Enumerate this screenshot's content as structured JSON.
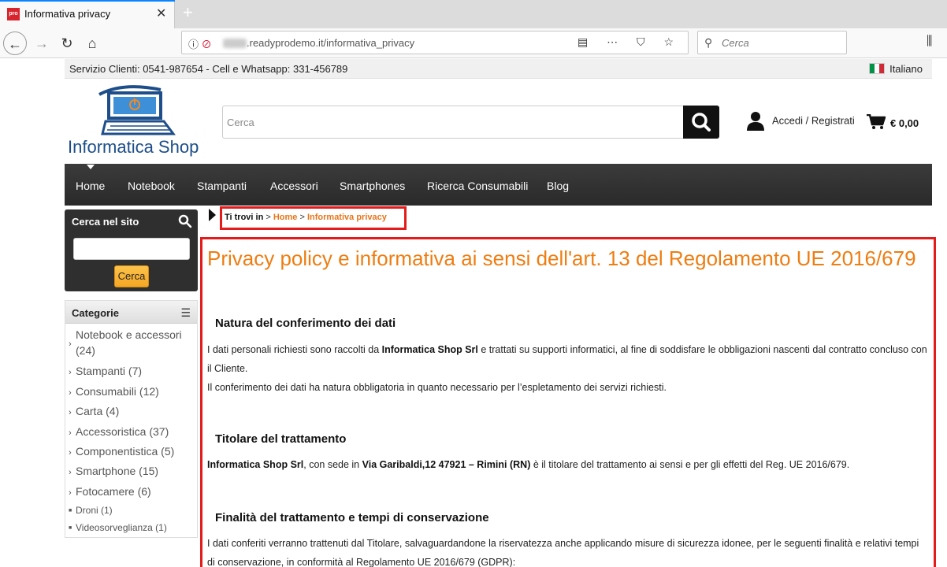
{
  "browser": {
    "tab_title": "Informativa privacy",
    "favicon_text": "pro",
    "url_prefix": "",
    "url": ".readyprodemo.it/informativa_privacy",
    "search_placeholder": "Cerca"
  },
  "topstrip": {
    "service": "Servizio Clienti: 0541-987654 - Cell e Whatsapp: 331-456789",
    "language": "Italiano"
  },
  "header": {
    "logo_text": "Informatica Shop",
    "search_placeholder": "Cerca",
    "login_label": "Accedi / Registrati",
    "cart_total": "€ 0,00"
  },
  "mainnav": {
    "items": [
      "Home",
      "Notebook",
      "Stampanti",
      "Accessori",
      "Smartphones",
      "Ricerca Consumabili",
      "Blog"
    ]
  },
  "sidebar": {
    "search_title": "Cerca nel sito",
    "search_button": "Cerca",
    "categories_title": "Categorie",
    "categories": [
      {
        "label": "Notebook e accessori",
        "count": "(24)"
      },
      {
        "label": "Stampanti (7)"
      },
      {
        "label": "Consumabili (12)"
      },
      {
        "label": "Carta (4)"
      },
      {
        "label": "Accessoristica (37)"
      },
      {
        "label": "Componentistica (5)"
      },
      {
        "label": "Smartphone (15)"
      },
      {
        "label": "Fotocamere (6)"
      },
      {
        "label": "Droni (1)"
      },
      {
        "label": "Videosorveglianza (1)"
      }
    ]
  },
  "breadcrumb": {
    "prefix": "Ti trovi in",
    "sep1": " > ",
    "home": "Home",
    "sep2": " > ",
    "current": "Informativa privacy"
  },
  "content": {
    "title": "Privacy policy e informativa ai sensi dell'art. 13 del Regolamento UE 2016/679",
    "s1_title": "Natura del conferimento dei dati",
    "s1_p1_a": "I dati personali richiesti sono raccolti da ",
    "s1_p1_b": "Informatica Shop Srl",
    "s1_p1_c": " e trattati su supporti informatici, al fine di soddisfare le obbligazioni nascenti dal contratto concluso con il Cliente.",
    "s1_p2": "Il conferimento dei dati ha natura obbligatoria in quanto necessario per l’espletamento dei servizi richiesti.",
    "s2_title": "Titolare del trattamento",
    "s2_p_a": "Informatica Shop Srl",
    "s2_p_b": ", con sede in ",
    "s2_p_c": "Via Garibaldi,12 47921 – Rimini (RN)",
    "s2_p_d": " è il titolare del trattamento ai sensi e per gli effetti del Reg. UE 2016/679.",
    "s3_title": "Finalità del trattamento e tempi di conservazione",
    "s3_p": "I dati conferiti verranno trattenuti dal Titolare, salvaguardandone la riservatezza anche applicando misure di sicurezza idonee, per le seguenti finalità e relativi tempi di conservazione, in conformità al Regolamento UE 2016/679 (GDPR):"
  },
  "colors": {
    "accent_orange": "#ee7d12",
    "highlight_red": "#e31b1b",
    "nav_dark": "#2f2f2f"
  }
}
